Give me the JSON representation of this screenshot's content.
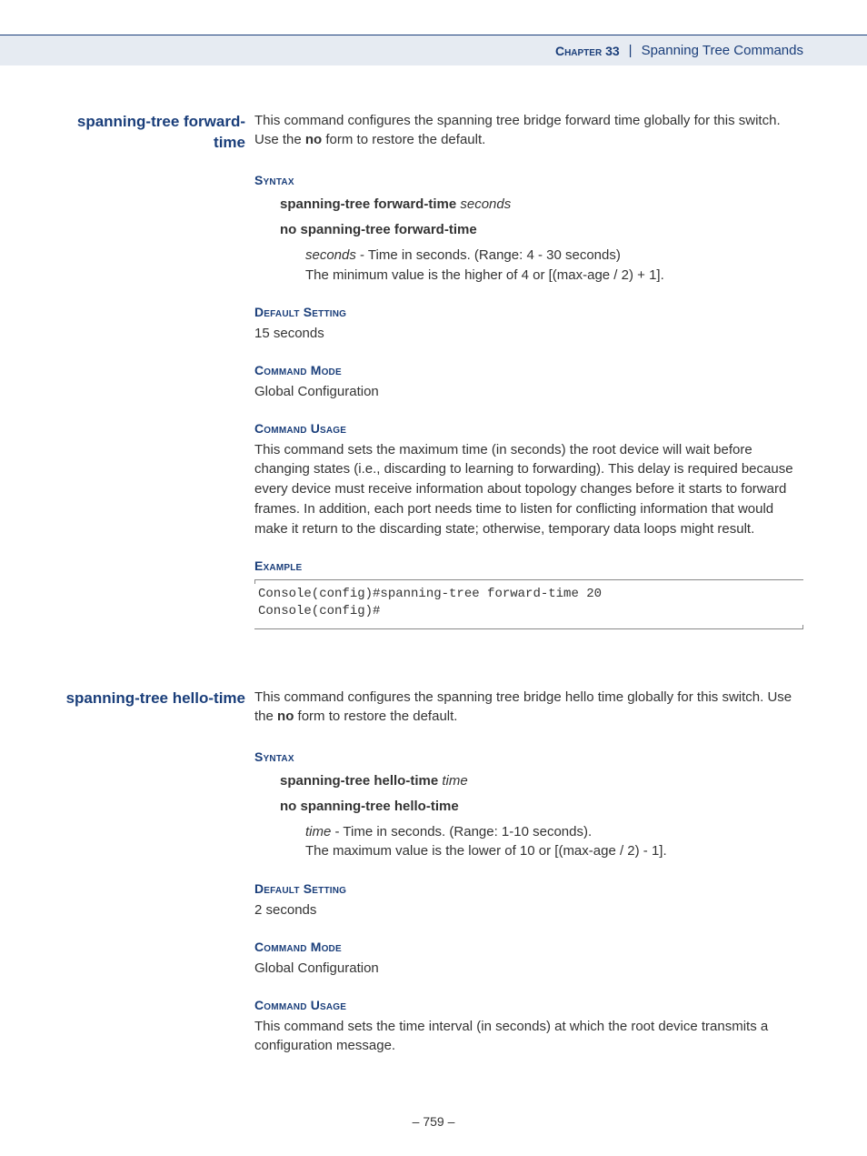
{
  "header": {
    "chapter_word": "Chapter",
    "chapter_num": "33",
    "divider": "|",
    "title": "Spanning Tree Commands"
  },
  "cmd1": {
    "margin": "spanning-tree forward-time",
    "intro_a": "This command configures the spanning tree bridge forward time globally for this switch. Use the ",
    "intro_bold": "no",
    "intro_b": " form to restore the default.",
    "syntax_label": "Syntax",
    "syntax_line1_bold": "spanning-tree forward-time",
    "syntax_line1_arg": "seconds",
    "syntax_line2_bold": "no spanning-tree forward-time",
    "arg_italic": "seconds",
    "arg_rest": " - Time in seconds. (Range: 4 - 30 seconds)",
    "arg_line2": "The minimum value is the higher of 4 or [(max-age / 2) + 1].",
    "default_label": "Default Setting",
    "default_val": "15 seconds",
    "mode_label": "Command Mode",
    "mode_val": "Global Configuration",
    "usage_label": "Command Usage",
    "usage_text": "This command sets the maximum time (in seconds) the root device will wait before changing states (i.e., discarding to learning to forwarding). This delay is required because every device must receive information about topology changes before it starts to forward frames. In addition, each port needs time to listen for conflicting information that would make it return to the discarding state; otherwise, temporary data loops might result.",
    "example_label": "Example",
    "example_code": "Console(config)#spanning-tree forward-time 20\nConsole(config)#"
  },
  "cmd2": {
    "margin": "spanning-tree hello-time",
    "intro_a": "This command configures the spanning tree bridge hello time globally for this switch. Use the ",
    "intro_bold": "no",
    "intro_b": " form to restore the default.",
    "syntax_label": "Syntax",
    "syntax_line1_bold": "spanning-tree hello-time",
    "syntax_line1_arg": "time",
    "syntax_line2_bold": "no spanning-tree hello-time",
    "arg_italic": "time",
    "arg_rest": " - Time in seconds. (Range: 1-10 seconds).",
    "arg_line2": "The maximum value is the lower of 10 or [(max-age / 2) - 1].",
    "default_label": "Default Setting",
    "default_val": "2 seconds",
    "mode_label": "Command Mode",
    "mode_val": "Global Configuration",
    "usage_label": "Command Usage",
    "usage_text": "This command sets the time interval (in seconds) at which the root device transmits a configuration message."
  },
  "page_number": "–  759  –"
}
